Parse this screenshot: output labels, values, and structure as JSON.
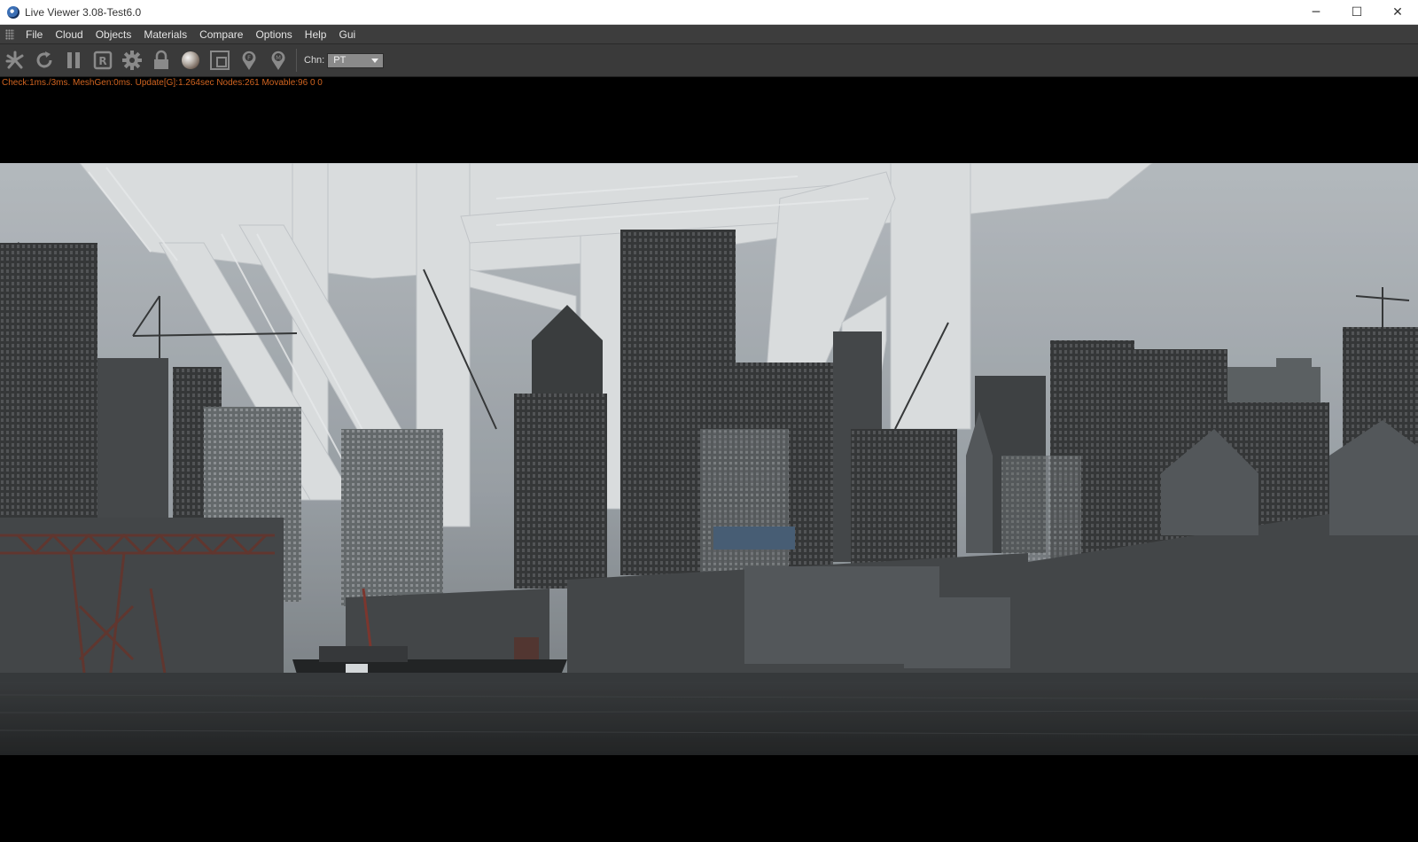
{
  "window": {
    "title": "Live Viewer 3.08-Test6.0",
    "controls": {
      "minimize": "─",
      "maximize": "☐",
      "close": "✕"
    }
  },
  "menu": {
    "items": [
      "File",
      "Cloud",
      "Objects",
      "Materials",
      "Compare",
      "Options",
      "Help",
      "Gui"
    ]
  },
  "toolbar": {
    "tools": [
      "scene-tree-icon",
      "refresh-icon",
      "pause-icon",
      "render-r-icon",
      "settings-gear-icon",
      "lock-icon",
      "material-sphere-icon",
      "region-icon",
      "pin-f-icon",
      "pin-m-icon"
    ],
    "r_label": "R",
    "f_label": "F",
    "m_label": "M",
    "channel_label": "Chn:",
    "channel_value": "PT"
  },
  "status": {
    "text": "Check:1ms./3ms. MeshGen:0ms. Update[G]:1.264sec Nodes:261 Movable:96  0 0"
  },
  "colors": {
    "status_text": "#d06420",
    "menu_bg": "#3d3d3d",
    "toolbar_bg": "#3a3a3a",
    "viewport_bg": "#000000"
  }
}
